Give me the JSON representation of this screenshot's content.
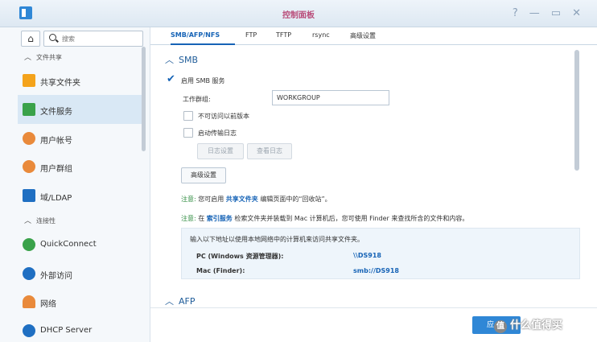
{
  "window": {
    "title": "控制面板",
    "controls": [
      "?",
      "—",
      "▭",
      "✕"
    ]
  },
  "search": {
    "placeholder": "搜索"
  },
  "sidebar": {
    "sections": [
      {
        "title": "文件共享"
      },
      {
        "title": "连接性"
      }
    ],
    "items": [
      {
        "label": "共享文件夹",
        "icon": "shared-folder-icon",
        "color": "#f4a31b"
      },
      {
        "label": "文件服务",
        "icon": "file-services-icon",
        "color": "#3aa24a"
      },
      {
        "label": "用户帐号",
        "icon": "user-icon",
        "color": "#e98a3b"
      },
      {
        "label": "用户群组",
        "icon": "user-group-icon",
        "color": "#e98a3b"
      },
      {
        "label": "域/LDAP",
        "icon": "domain-ldap-icon",
        "color": "#1f6fc2"
      },
      {
        "label": "QuickConnect",
        "icon": "quickconnect-icon",
        "color": "#3aa24a"
      },
      {
        "label": "外部访问",
        "icon": "external-access-icon",
        "color": "#1f6fc2"
      },
      {
        "label": "网络",
        "icon": "network-icon",
        "color": "#e98a3b"
      },
      {
        "label": "DHCP Server",
        "icon": "dhcp-server-icon",
        "color": "#1f6fc2"
      }
    ],
    "active_index": 1
  },
  "tabs": [
    "SMB/AFP/NFS",
    "FTP",
    "TFTP",
    "rsync",
    "高级设置"
  ],
  "active_tab": 0,
  "smb": {
    "section_title": "SMB",
    "enable_label": "启用 SMB 服务",
    "enabled": true,
    "workgroup_label": "工作群组:",
    "workgroup_value": "WORKGROUP",
    "prev_versions_label": "不可访问以前版本",
    "transfer_log_label": "启动传输日志",
    "log_settings_btn": "日志设置",
    "view_log_btn": "查看日志",
    "advanced_btn": "高级设置",
    "note1": {
      "prefix": "注意:",
      "text1": "您可启用",
      "link": "共享文件夹",
      "text2": "编辑页面中的“回收站”。"
    },
    "note2": {
      "prefix": "注意:",
      "text1": "在",
      "link": "索引服务",
      "text2": "检索文件夹并装载到 Mac 计算机后，您可使用 Finder 来查找所含的文件和内容。"
    },
    "info": {
      "intro": "输入以下地址以使用本地网络中的计算机来访问共享文件夹。",
      "pc_label": "PC (Windows 资源管理器):",
      "pc_value": "\\\\DS918",
      "mac_label": "Mac (Finder):",
      "mac_value": "smb://DS918"
    }
  },
  "afp": {
    "section_title": "AFP"
  },
  "footer": {
    "apply_label": "应",
    "watermark": "什么值得买",
    "watermark_badge": "值"
  }
}
